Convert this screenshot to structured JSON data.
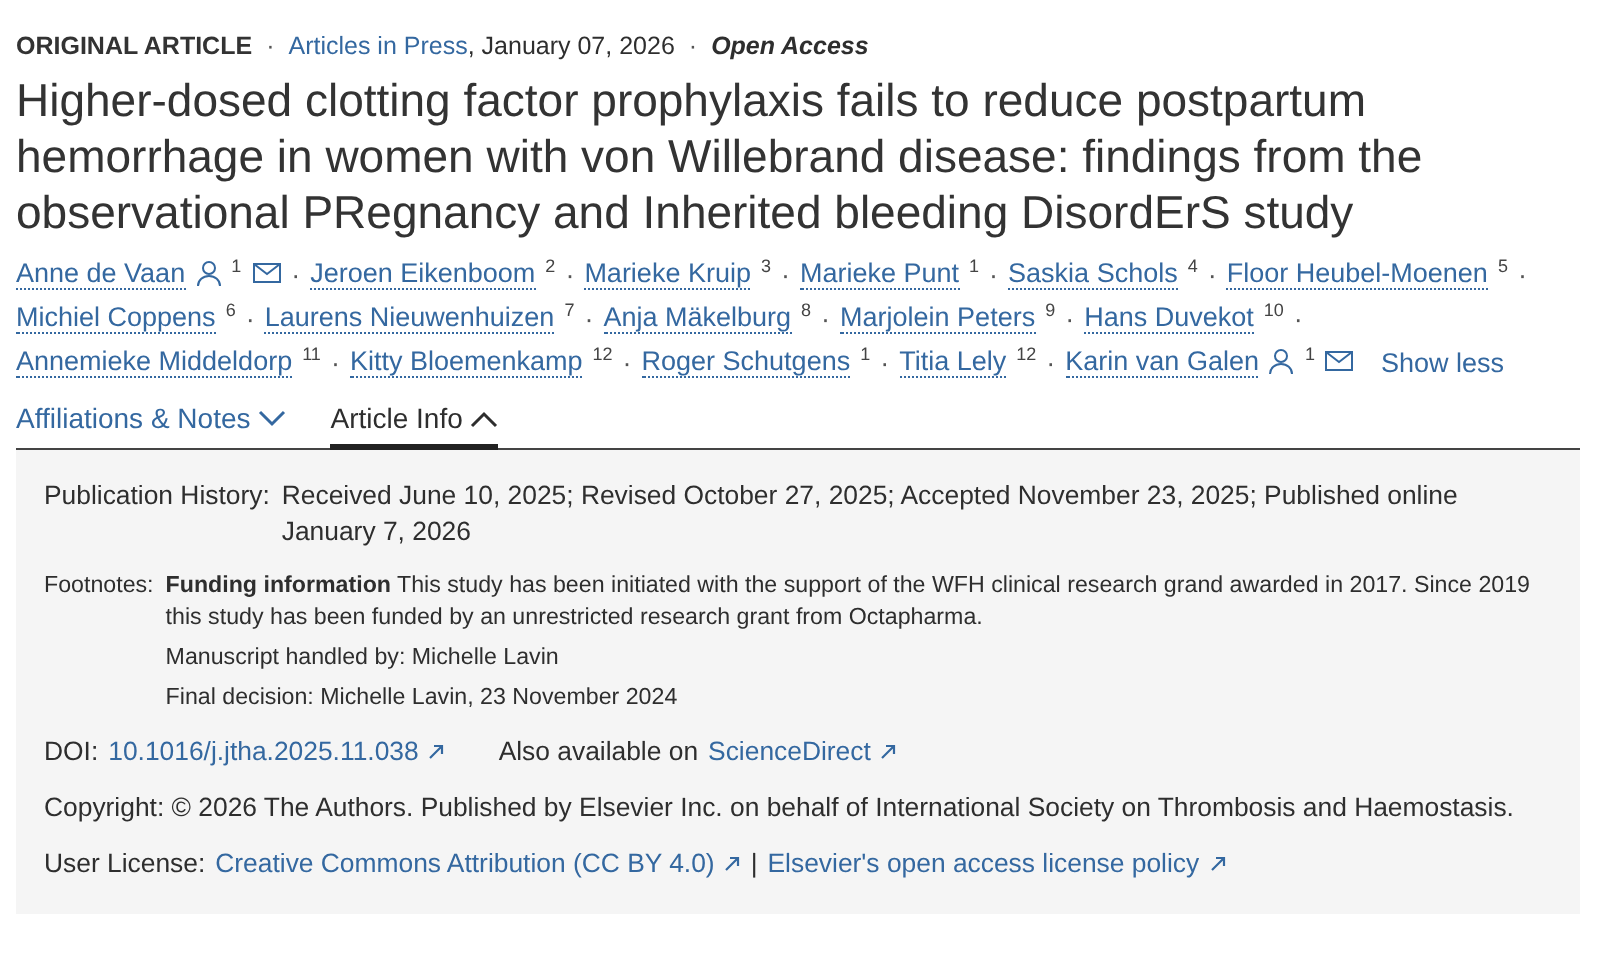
{
  "meta": {
    "article_type": "ORIGINAL ARTICLE",
    "separator_1": "·",
    "issue_link": "Articles in Press",
    "date": ", January 07, 2026",
    "separator_2": "·",
    "access": "Open Access"
  },
  "title": "Higher-dosed clotting factor prophylaxis fails to reduce postpartum hemorrhage in women with von Willebrand disease: findings from the observational PRegnancy and Inherited bleeding DisordErS study",
  "author_lines": [
    [
      {
        "name": "Anne de Vaan",
        "sup": "1",
        "corresponding": true,
        "separator": "·"
      },
      {
        "name": "Jeroen Eikenboom",
        "sup": "2",
        "corresponding": false,
        "separator": "·"
      },
      {
        "name": "Marieke Kruip",
        "sup": "3",
        "corresponding": false,
        "separator": "·"
      },
      {
        "name": "Marieke Punt",
        "sup": "1",
        "corresponding": false,
        "separator": "·"
      },
      {
        "name": "Saskia Schols",
        "sup": "4",
        "corresponding": false,
        "separator": "·"
      },
      {
        "name": "Floor Heubel-Moenen",
        "sup": "5",
        "corresponding": false,
        "separator": "·"
      }
    ],
    [
      {
        "name": "Michiel Coppens",
        "sup": "6",
        "corresponding": false,
        "separator": "·"
      },
      {
        "name": "Laurens Nieuwenhuizen",
        "sup": "7",
        "corresponding": false,
        "separator": "·"
      },
      {
        "name": "Anja Mäkelburg",
        "sup": "8",
        "corresponding": false,
        "separator": "·"
      },
      {
        "name": "Marjolein Peters",
        "sup": "9",
        "corresponding": false,
        "separator": "·"
      },
      {
        "name": "Hans Duvekot",
        "sup": "10",
        "corresponding": false,
        "separator": "·"
      }
    ],
    [
      {
        "name": "Annemieke Middeldorp",
        "sup": "11",
        "corresponding": false,
        "separator": "·"
      },
      {
        "name": "Kitty Bloemenkamp",
        "sup": "12",
        "corresponding": false,
        "separator": "·"
      },
      {
        "name": "Roger Schutgens",
        "sup": "1",
        "corresponding": false,
        "separator": "·"
      },
      {
        "name": "Titia Lely",
        "sup": "12",
        "corresponding": false,
        "separator": "·"
      },
      {
        "name": "Karin van Galen",
        "sup": "1",
        "corresponding": true
      }
    ]
  ],
  "show_less": "Show less",
  "tabs": [
    {
      "label": "Affiliations & Notes",
      "selected": false,
      "expanded": false
    },
    {
      "label": "Article Info",
      "selected": true,
      "expanded": true
    }
  ],
  "info": {
    "publication_history": {
      "label": "Publication History:",
      "value": "Received June 10, 2025; Revised October 27, 2025; Accepted November 23, 2025; Published online January 7, 2026"
    },
    "footnotes": {
      "label": "Footnotes:",
      "items": [
        "**Funding information** This study has been initiated with the support of the WFH clinical research grand awarded in 2017. Since 2019 this study has been funded by an unrestricted research grant from Octapharma.",
        "Manuscript handled by: Michelle Lavin",
        "Final decision: Michelle Lavin, 23 November 2024"
      ]
    },
    "doi": {
      "label": "DOI:",
      "link": "10.1016/j.jtha.2025.11.038",
      "also_text": "Also available on",
      "also_link": "ScienceDirect"
    },
    "copyright": "Copyright: © 2026 The Authors. Published by Elsevier Inc. on behalf of International Society on Thrombosis and Haemostasis.",
    "license": {
      "label": "User License:",
      "link": "Creative Commons Attribution (CC BY 4.0)",
      "separator": "|",
      "policy_link": "Elsevier's open access license policy"
    }
  }
}
